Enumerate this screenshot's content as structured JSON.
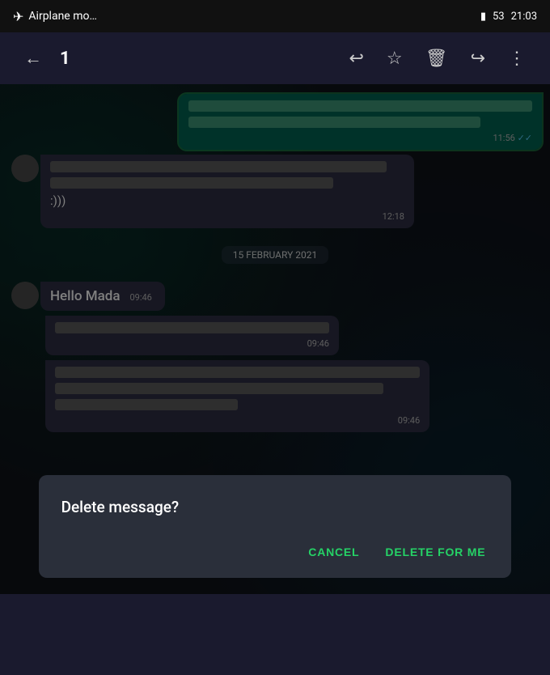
{
  "statusBar": {
    "carrier": "Airplane mo…",
    "battery": "53",
    "time": "21:03"
  },
  "actionBar": {
    "back_label": "←",
    "count": "1",
    "reply_icon": "↩",
    "star_icon": "★",
    "delete_icon": "🗑",
    "forward_icon": "↪",
    "more_icon": "⋮"
  },
  "messages": [
    {
      "type": "outgoing-redacted",
      "time": "11:56",
      "ticks": "✓✓",
      "selected": true
    },
    {
      "type": "incoming",
      "text": ":)))",
      "time": "12:18",
      "redacted_lines": [
        1
      ]
    },
    {
      "type": "date-divider",
      "label": "15 FEBRUARY 2021"
    },
    {
      "type": "incoming-text",
      "text": "Hello Mada",
      "time": "09:46"
    },
    {
      "type": "incoming-redacted",
      "time": "09:46",
      "bars": [
        1
      ]
    },
    {
      "type": "incoming-redacted-long",
      "time": "09:46",
      "bars": [
        2
      ]
    }
  ],
  "dialog": {
    "title": "Delete message?",
    "cancel_label": "CANCEL",
    "delete_label": "DELETE FOR ME"
  }
}
